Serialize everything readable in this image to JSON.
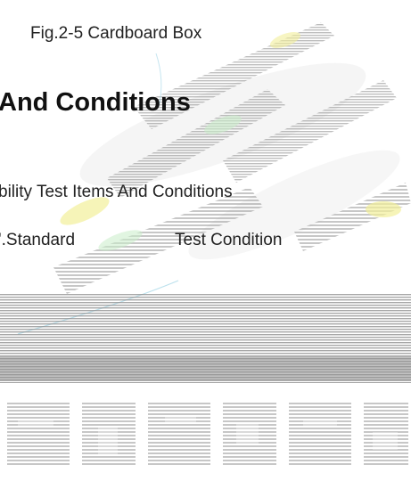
{
  "figure": {
    "caption": "Fig.2-5 Cardboard Box"
  },
  "section": {
    "heading": "And Conditions",
    "subheading": "bility Test Items And Conditions"
  },
  "table": {
    "columns": [
      "'.Standard",
      "Test Condition"
    ]
  },
  "colors": {
    "text": "#222222",
    "watermark_gray": "#8a8a8a",
    "watermark_yellow": "#f2ef9a",
    "watermark_green": "#c9ecc9"
  }
}
